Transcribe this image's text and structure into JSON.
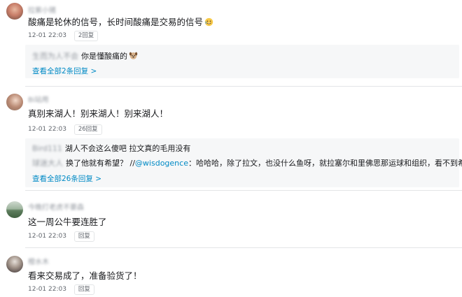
{
  "comments": [
    {
      "username": "拉紫小猪",
      "text": "酸痛是轮休的信号，长时间酸痛是交易的信号",
      "time": "12-01 22:03",
      "reply_button": "2回复",
      "replies": [
        {
          "name": "生而为人不会",
          "text": "你是懂酸痛的"
        }
      ],
      "more": "查看全部2条回复 >"
    },
    {
      "username": "Bi站用",
      "text": "真别来湖人！别来湖人！别来湖人！",
      "time": "12-01 22:03",
      "reply_button": "26回复",
      "replies": [
        {
          "name": "Bird111",
          "text": "湖人不会这么傻吧 拉文真的毛用没有"
        },
        {
          "name": "球迷大人",
          "text_before": "换了他就有希望？ //",
          "mention": "@wisdogence",
          "text_after": "：哈哈哈，除了拉文，也没什么鱼呀，就拉塞尔和里佛思那运球和组织，看不到希望"
        }
      ],
      "more": "查看全部26条回复 >"
    },
    {
      "username": "今晚打老虎不要森",
      "text": "这一周公牛要连胜了",
      "time": "12-01 22:03",
      "reply_button": "回复"
    },
    {
      "username": "橙水木",
      "text": "看来交易成了，准备验货了！",
      "time": "12-01 22:03",
      "reply_button": "回复"
    }
  ],
  "icons": {
    "emoji_1": "crying-laugh-icon",
    "emoji_2": "dog-face-icon",
    "emoji_3": "crying-laugh-icon"
  },
  "colors": {
    "link": "#008ac5",
    "muted": "#9499a0",
    "reply_bg": "#f6f7f8"
  }
}
